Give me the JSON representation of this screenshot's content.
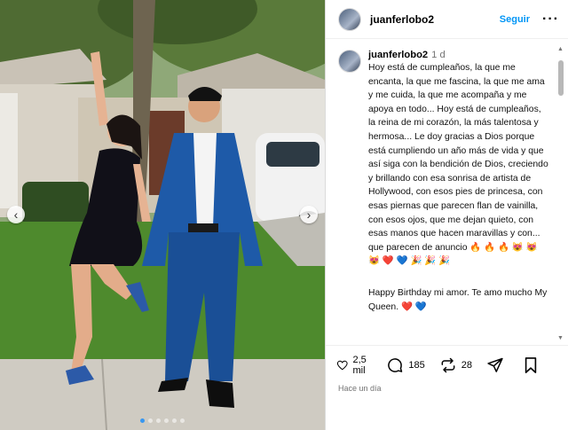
{
  "post": {
    "username": "juanferlobo2",
    "follow_label": "Seguir",
    "more_label": "···"
  },
  "caption": {
    "username": "juanferlobo2",
    "time": "1 d",
    "text": "Hoy está de cumpleaños, la que me encanta, la que me fascina, la que me ama y me cuida, la que me acompaña y me apoya en todo... Hoy está de cumpleaños, la reina de mi corazón, la más talentosa y hermosa... Le doy gracias a Dios porque está cumpliendo un año más de vida y que así siga con la bendición de Dios, creciendo y brillando con esa sonrisa de artista de Hollywood, con esos pies de princesa, con esas piernas que parecen flan de vainilla, con esos ojos, que me dejan quieto, con esas manos que hacen maravillas y con... que parecen de anuncio 🔥 🔥 🔥 😻 😻 😻 ❤️ 💙 🎉 🎉 🎉",
    "text2": "Happy Birthday mi amor. Te amo mucho My Queen. ❤️ 💙"
  },
  "stats": {
    "likes": "2,5 mil",
    "comments": "185",
    "reposts": "28",
    "posted": "Hace un día"
  },
  "carousel": {
    "prev_icon": "chevron-left-icon",
    "next_icon": "chevron-right-icon",
    "active_index": 0,
    "count": 6
  },
  "icons": {
    "like": "heart-icon",
    "comment": "comment-icon",
    "repost": "repost-icon",
    "share": "send-icon",
    "save": "bookmark-icon"
  },
  "colors": {
    "accent": "#0095f6",
    "muted": "#737373",
    "border": "#dbdbdb"
  }
}
